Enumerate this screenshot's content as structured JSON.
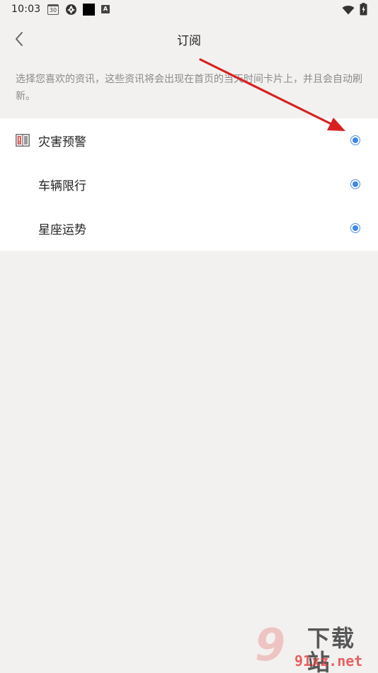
{
  "status_bar": {
    "time": "10:03",
    "calendar_day": "30",
    "icons": [
      "calendar-icon",
      "aperture-icon",
      "black-square-icon",
      "a-icon",
      "wifi-icon",
      "battery-icon"
    ]
  },
  "header": {
    "title": "订阅",
    "back_icon": "chevron-left-icon"
  },
  "description": "选择您喜欢的资讯，这些资讯将会出现在首页的当天时间卡片上，并且会自动刷新。",
  "subscriptions": [
    {
      "label": "灾害预警",
      "icon": "warning-book-icon",
      "selected": true
    },
    {
      "label": "车辆限行",
      "icon": null,
      "selected": true
    },
    {
      "label": "星座运势",
      "icon": null,
      "selected": true
    }
  ],
  "colors": {
    "background": "#f2f1f0",
    "card": "#ffffff",
    "accent": "#3b87ea",
    "arrow": "#d92020",
    "description_text": "#8a8a8a"
  },
  "watermark": {
    "mark": "9",
    "text": "下载站",
    "url": "91xz.net"
  }
}
